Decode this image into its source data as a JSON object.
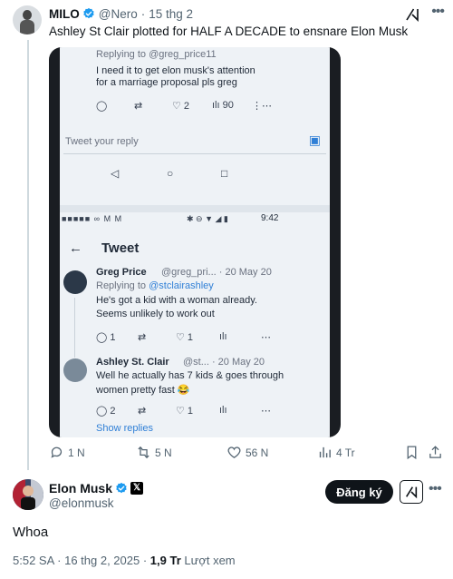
{
  "quoted_post": {
    "author_name": "MILO",
    "handle": "@Nero",
    "separator": "·",
    "date": "15 thg 2",
    "text": "Ashley St Clair plotted for HALF A DECADE to ensnare Elon Musk",
    "photo": {
      "top_reply_to": "Replying to @greg_price11",
      "top_text_1": "I need it to get elon musk's attention",
      "top_text_2": "for a marriage proposal pls greg",
      "top_reply_count": "2",
      "top_views": "90",
      "reply_placeholder": "Tweet your reply",
      "status_time": "9:42",
      "header_title": "Tweet",
      "reply1_name": "Greg Price",
      "reply1_meta": "@greg_pri... · 20 May 20",
      "reply1_replying": "Replying to",
      "reply1_replying_handle": "@stclairashley",
      "reply1_line1": "He's got a kid with a woman already.",
      "reply1_line2": "Seems unlikely to work out",
      "reply1_c1": "1",
      "reply1_c3": "1",
      "reply2_name": "Ashley St. Clair",
      "reply2_meta": "@st... · 20 May 20",
      "reply2_line1": "Well he actually has 7 kids & goes through",
      "reply2_line2": "women pretty fast 😂",
      "reply2_c1": "2",
      "reply2_c3": "1",
      "show_replies": "Show replies"
    },
    "actions": {
      "replies": "1 N",
      "reposts": "5 N",
      "likes": "56 N",
      "views": "4 Tr"
    }
  },
  "main_post": {
    "author_name": "Elon Musk",
    "handle": "@elonmusk",
    "follow_label": "Đăng ký",
    "text": "Whoa",
    "timestamp": "5:52 SA · 16 thg 2, 2025 ·",
    "views_count": "1,9 Tr",
    "views_label": "Lượt xem"
  },
  "colors": {
    "verified": "#1d9bf0",
    "muted": "#536471",
    "text": "#0f1419"
  }
}
